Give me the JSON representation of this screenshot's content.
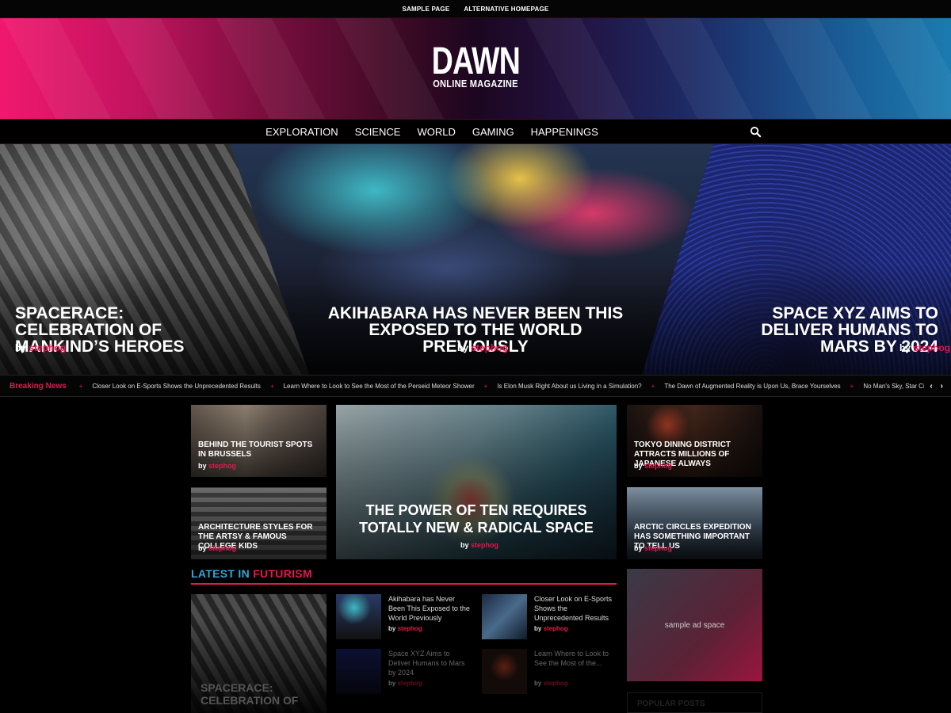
{
  "top_links": [
    "SAMPLE PAGE",
    "ALTERNATIVE HOMEPAGE"
  ],
  "logo": {
    "title": "DAWN",
    "subtitle": "ONLINE MAGAZINE"
  },
  "nav": {
    "items": [
      "EXPLORATION",
      "SCIENCE",
      "WORLD",
      "GAMING",
      "HAPPENINGS"
    ],
    "search_icon": "search-icon"
  },
  "hero": [
    {
      "title": "SPACERACE: CELEBRATION OF MANKIND’S HEROES",
      "by": "by",
      "author": "stephog"
    },
    {
      "title": "AKIHABARA HAS NEVER BEEN THIS EXPOSED TO THE WORLD PREVIOUSLY",
      "by": "by",
      "author": "stephog"
    },
    {
      "title": "SPACE XYZ AIMS TO DELIVER HUMANS TO MARS BY 2024",
      "by": "by",
      "author": "stephog"
    }
  ],
  "ticker": {
    "label": "Breaking News",
    "items": [
      "Closer Look on E-Sports Shows the Unprecedented Results",
      "Learn Where to Look to See the Most of the Perseid Meteor Shower",
      "Is Elon Musk Right About us Living in a Simulation?",
      "The Dawn of Augmented Reality is Upon Us, Brace Yourselves",
      "No Man's Sky, Star Citizen and Elite: Dangerous are allies, not"
    ],
    "prev": "‹",
    "next": "›"
  },
  "cards": [
    {
      "title": "BEHIND THE TOURIST SPOTS IN BRUSSELS",
      "by": "by",
      "author": "stephog"
    },
    {
      "title": "ARCHITECTURE STYLES FOR THE ARTSY & FAMOUS COLLEGE KIDS",
      "by": "by",
      "author": "stephog"
    },
    {
      "title": "THE POWER OF TEN REQUIRES TOTALLY NEW & RADICAL SPACE",
      "by": "by",
      "author": "stephog"
    },
    {
      "title": "TOKYO DINING DISTRICT ATTRACTS MILLIONS OF JAPANESE ALWAYS",
      "by": "by",
      "author": "stephog"
    },
    {
      "title": "ARCTIC CIRCLES EXPEDITION HAS SOMETHING IMPORTANT TO TELL US",
      "by": "by",
      "author": "stephog"
    }
  ],
  "section": {
    "latest": "LATEST IN ",
    "category": "FUTURISM"
  },
  "big_thumb_title": "SPACERACE: CELEBRATION OF",
  "list": [
    {
      "title": "Akihabara has Never Been This Exposed to the World Previously",
      "by": "by",
      "author": "stephog"
    },
    {
      "title": "Closer Look on E-Sports Shows the Unprecedented Results",
      "by": "by",
      "author": "stephog"
    },
    {
      "title": "Space XYZ Aims to Deliver Humans to Mars by 2024",
      "by": "by",
      "author": "stephog"
    },
    {
      "title": "Learn Where to Look to See the Most of the...",
      "by": "by",
      "author": "stephog"
    }
  ],
  "ad": {
    "text": "sample ad space"
  },
  "popular": {
    "label": "POPULAR POSTS"
  },
  "colors": {
    "accent": "#e4174f",
    "blue": "#2ea6d9"
  }
}
